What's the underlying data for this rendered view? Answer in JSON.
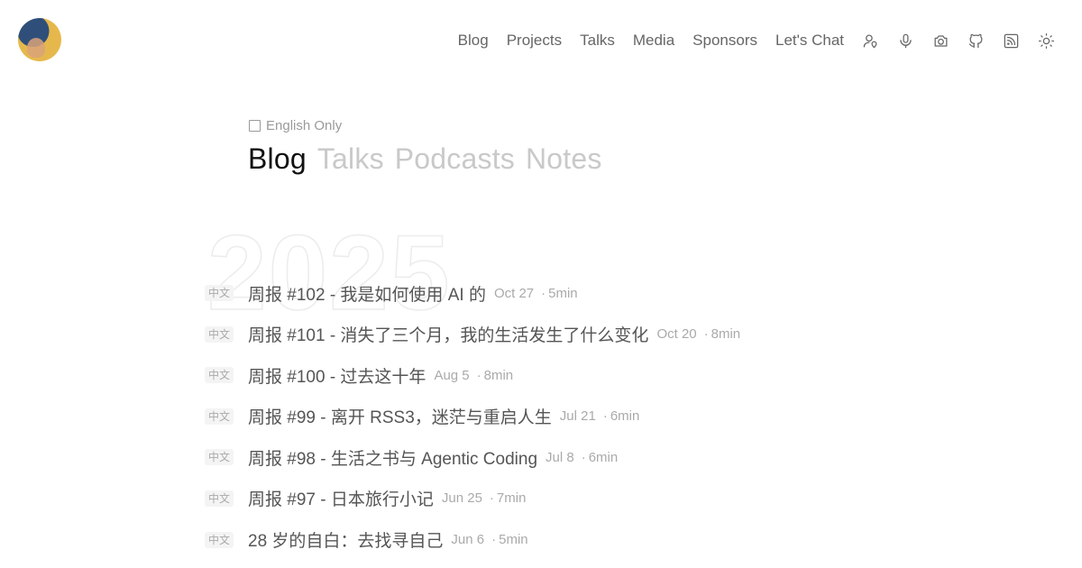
{
  "header": {
    "nav": [
      "Blog",
      "Projects",
      "Talks",
      "Media",
      "Sponsors",
      "Let's Chat"
    ],
    "icons": [
      "user-location-icon",
      "microphone-icon",
      "camera-icon",
      "github-icon",
      "rss-icon",
      "sun-icon"
    ]
  },
  "filter": {
    "label": "English Only",
    "checked": false
  },
  "tabs": [
    "Blog",
    "Talks",
    "Podcasts",
    "Notes"
  ],
  "active_tab": "Blog",
  "year": "2025",
  "posts": [
    {
      "lang": "中文",
      "title": "周报 #102 - 我是如何使用 AI 的",
      "date": "Oct 27",
      "duration": "5min"
    },
    {
      "lang": "中文",
      "title": "周报 #101 - 消失了三个月，我的生活发生了什么变化",
      "date": "Oct 20",
      "duration": "8min"
    },
    {
      "lang": "中文",
      "title": "周报 #100 - 过去这十年",
      "date": "Aug 5",
      "duration": "8min"
    },
    {
      "lang": "中文",
      "title": "周报 #99 - 离开 RSS3，迷茫与重启人生",
      "date": "Jul 21",
      "duration": "6min"
    },
    {
      "lang": "中文",
      "title": "周报 #98 - 生活之书与 Agentic Coding",
      "date": "Jul 8",
      "duration": "6min"
    },
    {
      "lang": "中文",
      "title": "周报 #97 - 日本旅行小记",
      "date": "Jun 25",
      "duration": "7min"
    },
    {
      "lang": "中文",
      "title": "28 岁的自白：去找寻自己",
      "date": "Jun 6",
      "duration": "5min"
    }
  ]
}
